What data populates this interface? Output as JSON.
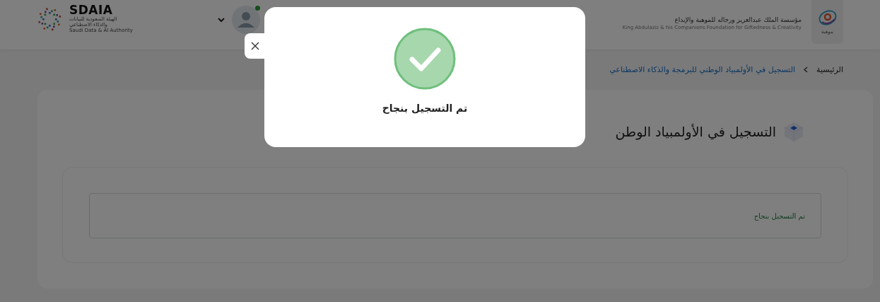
{
  "header": {
    "partner_logo": {
      "name": "SDAIA",
      "lines": [
        "الهيئة السعودية للبيانات",
        "والذكاء الاصطناعي",
        "Saudi Data & AI Authority"
      ]
    },
    "account": {
      "online": true
    },
    "org_logo": {
      "title": "مؤسسة الملك عبدالعزيز ورجاله للموهبة والإبداع",
      "subtitle": "King Abdulaziz & his Companions Foundation for Giftedness & Creativity",
      "caption": "موهبة"
    }
  },
  "breadcrumb": [
    {
      "label": "الرئيسية",
      "current": false
    },
    {
      "label": "التسجيل في الأولمبياد الوطني للبرمجة والذكاء الاصطناعي",
      "current": true
    }
  ],
  "page_title": "التسجيل في الأولمبياد الوطن",
  "alert": {
    "kind": "success",
    "message": "تم التسجيل بنجاح"
  },
  "modal": {
    "kind": "success",
    "message": "تم التسجيل بنجاح"
  }
}
